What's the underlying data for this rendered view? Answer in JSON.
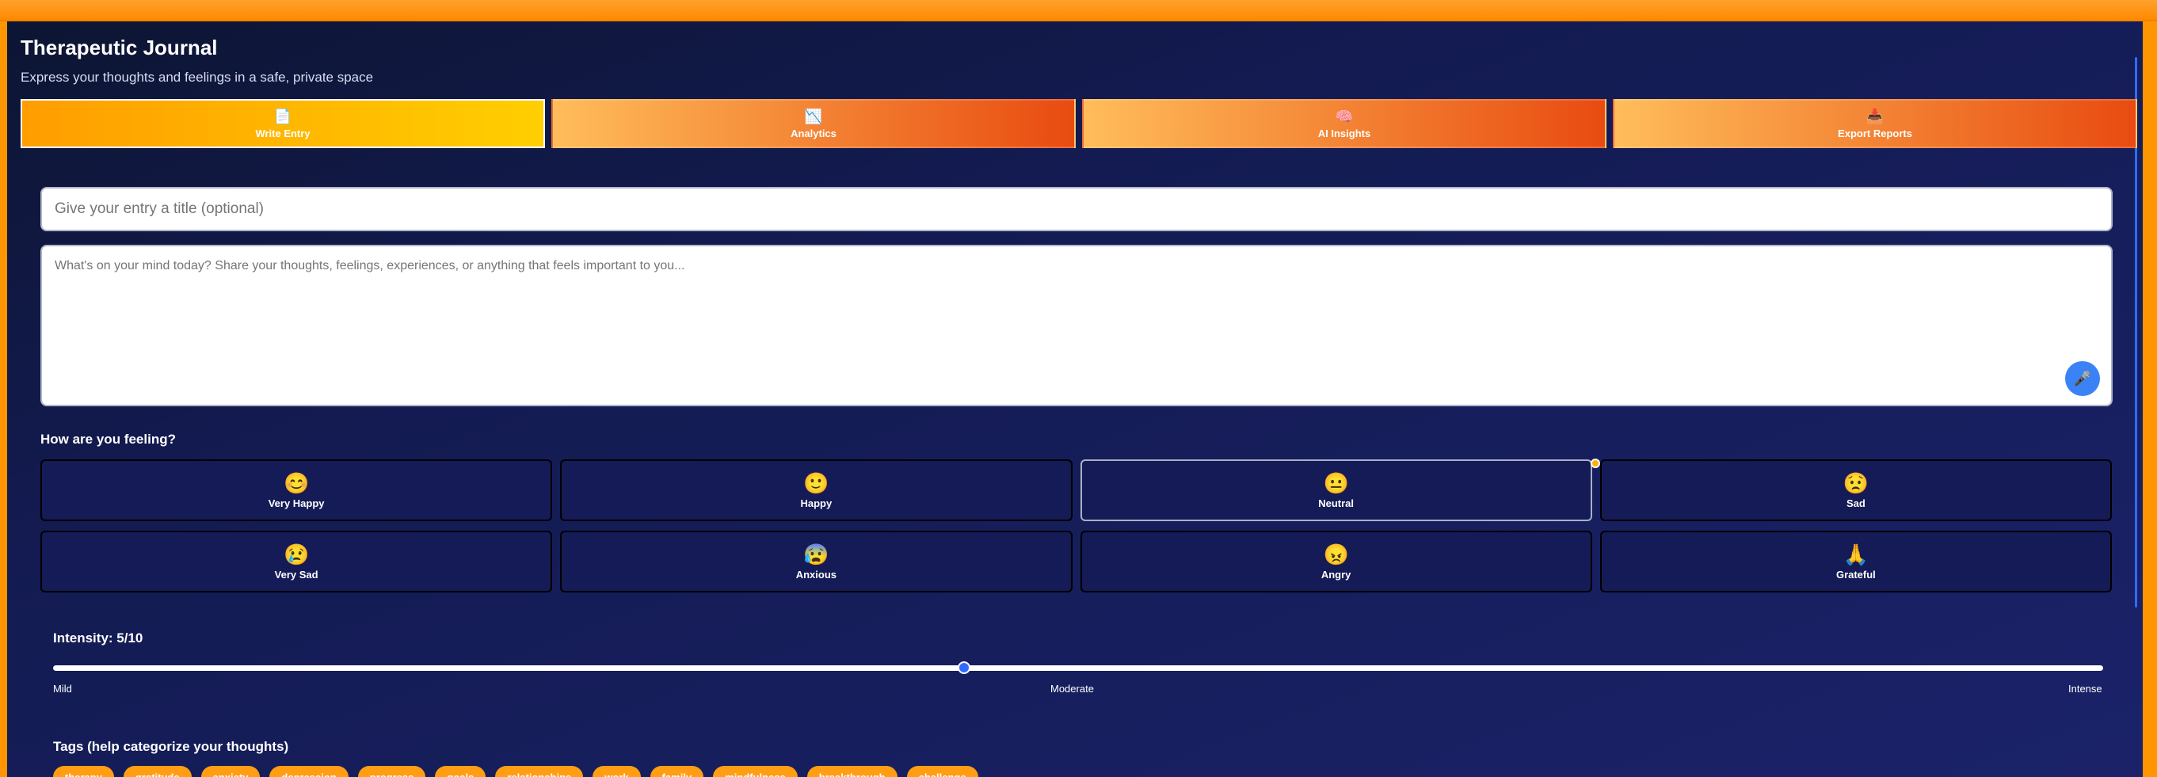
{
  "header": {
    "title": "Therapeutic Journal",
    "subtitle": "Express your thoughts and feelings in a safe, private space"
  },
  "tabs": [
    {
      "label": "Write Entry",
      "icon": "document-icon",
      "active": true
    },
    {
      "label": "Analytics",
      "icon": "chart-icon",
      "active": false
    },
    {
      "label": "AI Insights",
      "icon": "brain-icon",
      "active": false
    },
    {
      "label": "Export Reports",
      "icon": "download-icon",
      "active": false
    }
  ],
  "entry": {
    "title_placeholder": "Give your entry a title (optional)",
    "body_placeholder": "What's on your mind today? Share your thoughts, feelings, experiences, or anything that feels important to you..."
  },
  "mood_section": {
    "label": "How are you feeling?",
    "moods": [
      {
        "label": "Very Happy",
        "emoji": "😊",
        "selected": false
      },
      {
        "label": "Happy",
        "emoji": "🙂",
        "selected": false
      },
      {
        "label": "Neutral",
        "emoji": "😐",
        "selected": true
      },
      {
        "label": "Sad",
        "emoji": "😟",
        "selected": false
      },
      {
        "label": "Very Sad",
        "emoji": "😢",
        "selected": false
      },
      {
        "label": "Anxious",
        "emoji": "😰",
        "selected": false
      },
      {
        "label": "Angry",
        "emoji": "😠",
        "selected": false
      },
      {
        "label": "Grateful",
        "emoji": "🙏",
        "selected": false
      }
    ]
  },
  "intensity": {
    "label": "Intensity: 5/10",
    "value": 5,
    "min": 1,
    "max": 10,
    "ticks": [
      "Mild",
      "Moderate",
      "Intense"
    ]
  },
  "tags_section": {
    "label": "Tags (help categorize your thoughts)",
    "tags": [
      "therapy",
      "gratitude",
      "anxiety",
      "depression",
      "progress",
      "goals",
      "relationships",
      "work",
      "family",
      "mindfulness",
      "breakthrough",
      "challenge"
    ]
  },
  "colors": {
    "frame_orange": "#ff9500",
    "tab_active_gradient": [
      "#ff9d00",
      "#ffcf00"
    ],
    "tab_gradient": [
      "#ffbd5a",
      "#e84b10"
    ],
    "accent_blue": "#3b82f6",
    "tag_orange": "#ff9e13",
    "panel_bg": "#141b56"
  }
}
